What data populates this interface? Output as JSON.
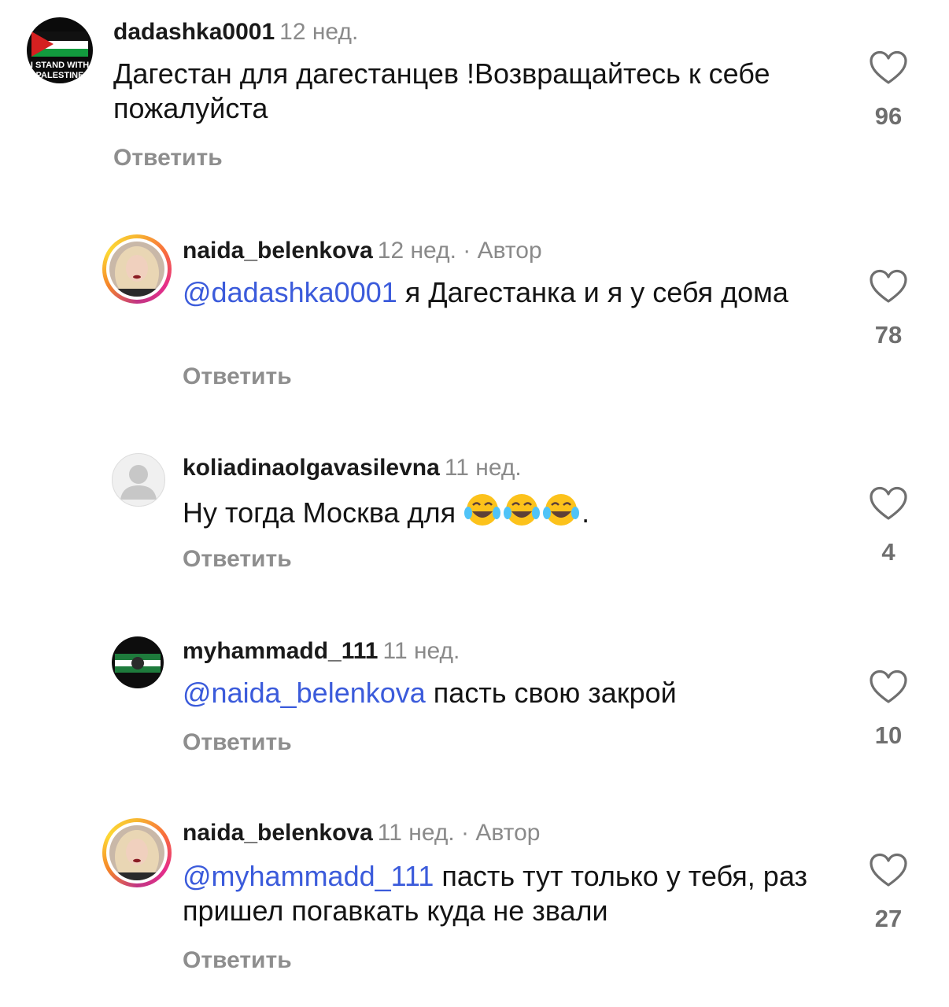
{
  "comments": [
    {
      "username": "dadashka0001",
      "time": "12 нед.",
      "text": "Дагестан для дагестанцев !Возвращайтесь к себе пожалуйста",
      "reply": "Ответить",
      "likes": "96",
      "avatar_caption_1": "I STAND WITH",
      "avatar_caption_2": "PALESTINE"
    },
    {
      "username": "naida_belenkova",
      "time": "12 нед.",
      "author_label": "· Автор",
      "mention": "@dadashka0001",
      "text": "я Дагестанка и я у себя дома",
      "reply": "Ответить",
      "likes": "78"
    },
    {
      "username": "koliadinaolgavasilevna",
      "time": "11 нед.",
      "text": "Ну тогда Москва для",
      "text_end": ".",
      "emoji": "face-with-tears-of-joy-icon",
      "reply": "Ответить",
      "likes": "4"
    },
    {
      "username": "myhammadd_111",
      "time": "11 нед.",
      "mention": "@naida_belenkova",
      "text": "пасть свою закрой",
      "reply": "Ответить",
      "likes": "10"
    },
    {
      "username": "naida_belenkova",
      "time": "11 нед.",
      "author_label": "· Автор",
      "mention": "@myhammadd_111",
      "text": "пасть тут только у тебя, раз пришел погавкать куда не звали",
      "reply": "Ответить",
      "likes": "27"
    }
  ],
  "colors": {
    "mention": "#3b5bdb",
    "muted": "#8e8e8e",
    "heart_outline": "#6f6f6f"
  }
}
